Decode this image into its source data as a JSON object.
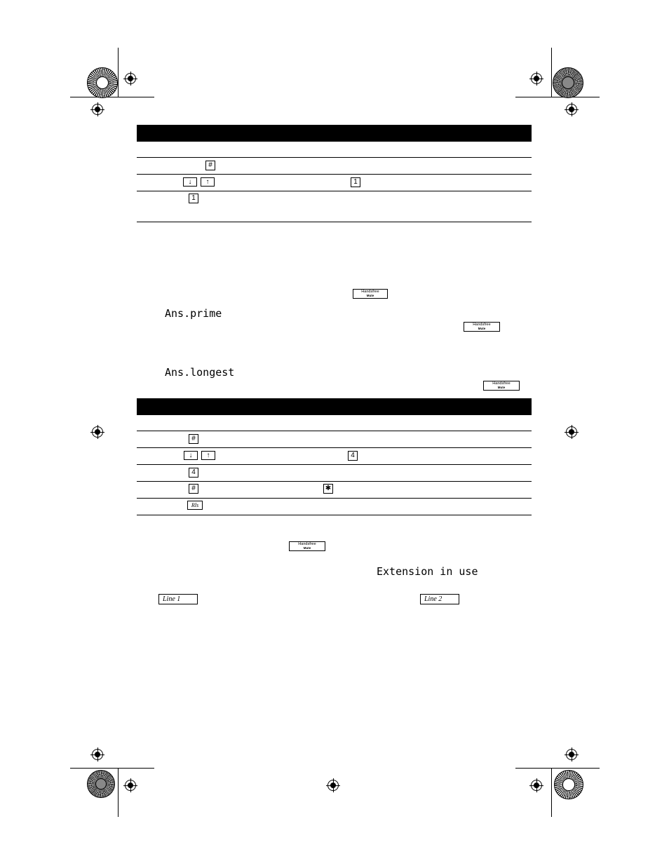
{
  "page": {
    "document_type": "telephone-user-guide-page",
    "background": "#ffffff",
    "ink": "#000000"
  },
  "sections": [
    {
      "id": "section-1",
      "heading_bar": {
        "label": ""
      },
      "rows": [
        {
          "id": "s1-row1",
          "keys": [
            {
              "name": "pound-key",
              "label": "#"
            }
          ]
        },
        {
          "id": "s1-row2",
          "keys": [
            {
              "name": "down-arrow-key",
              "label": "↓"
            },
            {
              "name": "up-arrow-key",
              "label": "↑"
            },
            {
              "name": "one-key",
              "label": "1"
            }
          ]
        },
        {
          "id": "s1-row3",
          "keys": [
            {
              "name": "one-key",
              "label": "1"
            }
          ]
        }
      ]
    },
    {
      "id": "section-2",
      "heading_bar": {
        "label": ""
      },
      "rows": [
        {
          "id": "s2-row1",
          "keys": [
            {
              "name": "pound-key",
              "label": "#"
            }
          ]
        },
        {
          "id": "s2-row2",
          "keys": [
            {
              "name": "down-arrow-key",
              "label": "↓"
            },
            {
              "name": "up-arrow-key",
              "label": "↑"
            },
            {
              "name": "four-key",
              "label": "4"
            }
          ]
        },
        {
          "id": "s2-row3",
          "keys": [
            {
              "name": "four-key",
              "label": "4"
            }
          ]
        },
        {
          "id": "s2-row4",
          "keys": [
            {
              "name": "pound-key",
              "label": "#"
            },
            {
              "name": "star-key",
              "label": "✱"
            }
          ]
        },
        {
          "id": "s2-row5",
          "keys": [
            {
              "name": "rls-key",
              "label": "Rls"
            }
          ]
        }
      ]
    }
  ],
  "handsfree_keys": [
    {
      "id": "hf-1",
      "top": "Handsfree",
      "bottom": "Mute"
    },
    {
      "id": "hf-2",
      "top": "Handsfree",
      "bottom": "Mute"
    },
    {
      "id": "hf-3",
      "top": "Handsfree",
      "bottom": "Mute"
    },
    {
      "id": "hf-4",
      "top": "Handsfree",
      "bottom": "Mute"
    }
  ],
  "display_messages": [
    {
      "id": "msg-ans-prime",
      "text": "Ans.prime"
    },
    {
      "id": "msg-ans-longest",
      "text": "Ans.longest"
    },
    {
      "id": "msg-extension-in-use",
      "text": "Extension in use"
    }
  ],
  "line_keys": [
    {
      "id": "line-1",
      "label": "Line 1"
    },
    {
      "id": "line-2",
      "label": "Line 2"
    }
  ]
}
